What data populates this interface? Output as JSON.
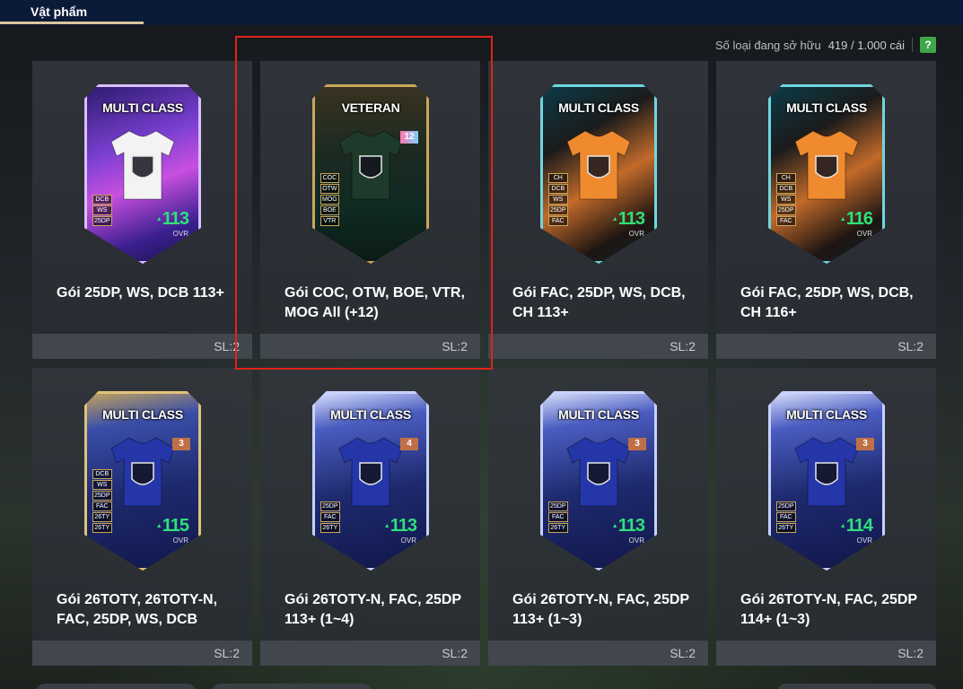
{
  "header": {
    "tab_label": "Vật phẩm",
    "owned_label": "Số loại đang sở hữu",
    "owned_value": "419 / 1.000 cái",
    "help_label": "?"
  },
  "items": [
    {
      "name": "Gói 25DP, WS, DCB 113+",
      "qty": "SL:2",
      "card": {
        "label": "MULTI CLASS",
        "ovr": "113",
        "ovr_label": "OVR",
        "tags": [
          "DCB",
          "WS",
          "25DP"
        ],
        "theme": "purple",
        "shirt_color": "#f3f3f3"
      }
    },
    {
      "name": "Gói COC, OTW, BOE, VTR, MOG All (+12)",
      "qty": "SL:2",
      "card": {
        "label": "VETERAN",
        "badge": "12",
        "tags": [
          "COC",
          "OTW",
          "MOG",
          "BOE",
          "VTR"
        ],
        "theme": "veteran",
        "shirt_color": "#1d3a2a"
      }
    },
    {
      "name": "Gói FAC, 25DP, WS, DCB, CH 113+",
      "qty": "SL:2",
      "card": {
        "label": "MULTI CLASS",
        "ovr": "113",
        "ovr_label": "OVR",
        "tags": [
          "CH",
          "DCB",
          "WS",
          "25DP",
          "FAC"
        ],
        "theme": "orange",
        "shirt_color": "#f08a2e"
      }
    },
    {
      "name": "Gói FAC, 25DP, WS, DCB, CH 116+",
      "qty": "SL:2",
      "card": {
        "label": "MULTI CLASS",
        "ovr": "116",
        "ovr_label": "OVR",
        "tags": [
          "CH",
          "DCB",
          "WS",
          "25DP",
          "FAC"
        ],
        "theme": "orange",
        "shirt_color": "#f08a2e"
      }
    },
    {
      "name": "Gói 26TOTY, 26TOTY-N, FAC, 25DP, WS, DCB",
      "qty": "SL:2",
      "card": {
        "label": "MULTI CLASS",
        "badge": "3",
        "ovr": "115",
        "ovr_label": "OVR",
        "tags": [
          "DCB",
          "WS",
          "25DP",
          "FAC",
          "26TY",
          "26TY"
        ],
        "theme": "toty-gold",
        "shirt_color": "#2436a8"
      }
    },
    {
      "name": "Gói 26TOTY-N, FAC, 25DP 113+ (1~4)",
      "qty": "SL:2",
      "card": {
        "label": "MULTI CLASS",
        "badge": "4",
        "ovr": "113",
        "ovr_label": "OVR",
        "tags": [
          "25DP",
          "FAC",
          "26TY"
        ],
        "theme": "toty",
        "shirt_color": "#2436a8"
      }
    },
    {
      "name": "Gói 26TOTY-N, FAC, 25DP 113+ (1~3)",
      "qty": "SL:2",
      "card": {
        "label": "MULTI CLASS",
        "badge": "3",
        "ovr": "113",
        "ovr_label": "OVR",
        "tags": [
          "25DP",
          "FAC",
          "26TY"
        ],
        "theme": "toty",
        "shirt_color": "#2436a8"
      }
    },
    {
      "name": "Gói 26TOTY-N, FAC, 25DP 114+ (1~3)",
      "qty": "SL:2",
      "card": {
        "label": "MULTI CLASS",
        "badge": "3",
        "ovr": "114",
        "ovr_label": "OVR",
        "tags": [
          "25DP",
          "FAC",
          "26TY"
        ],
        "theme": "toty",
        "shirt_color": "#2436a8"
      }
    }
  ],
  "colors": {
    "topbar": "#0c1a3a",
    "tab_underline": "#d7c79a",
    "highlight": "#e0241b",
    "ovr_green": "#2fe07a",
    "help_green": "#3fa64a"
  }
}
